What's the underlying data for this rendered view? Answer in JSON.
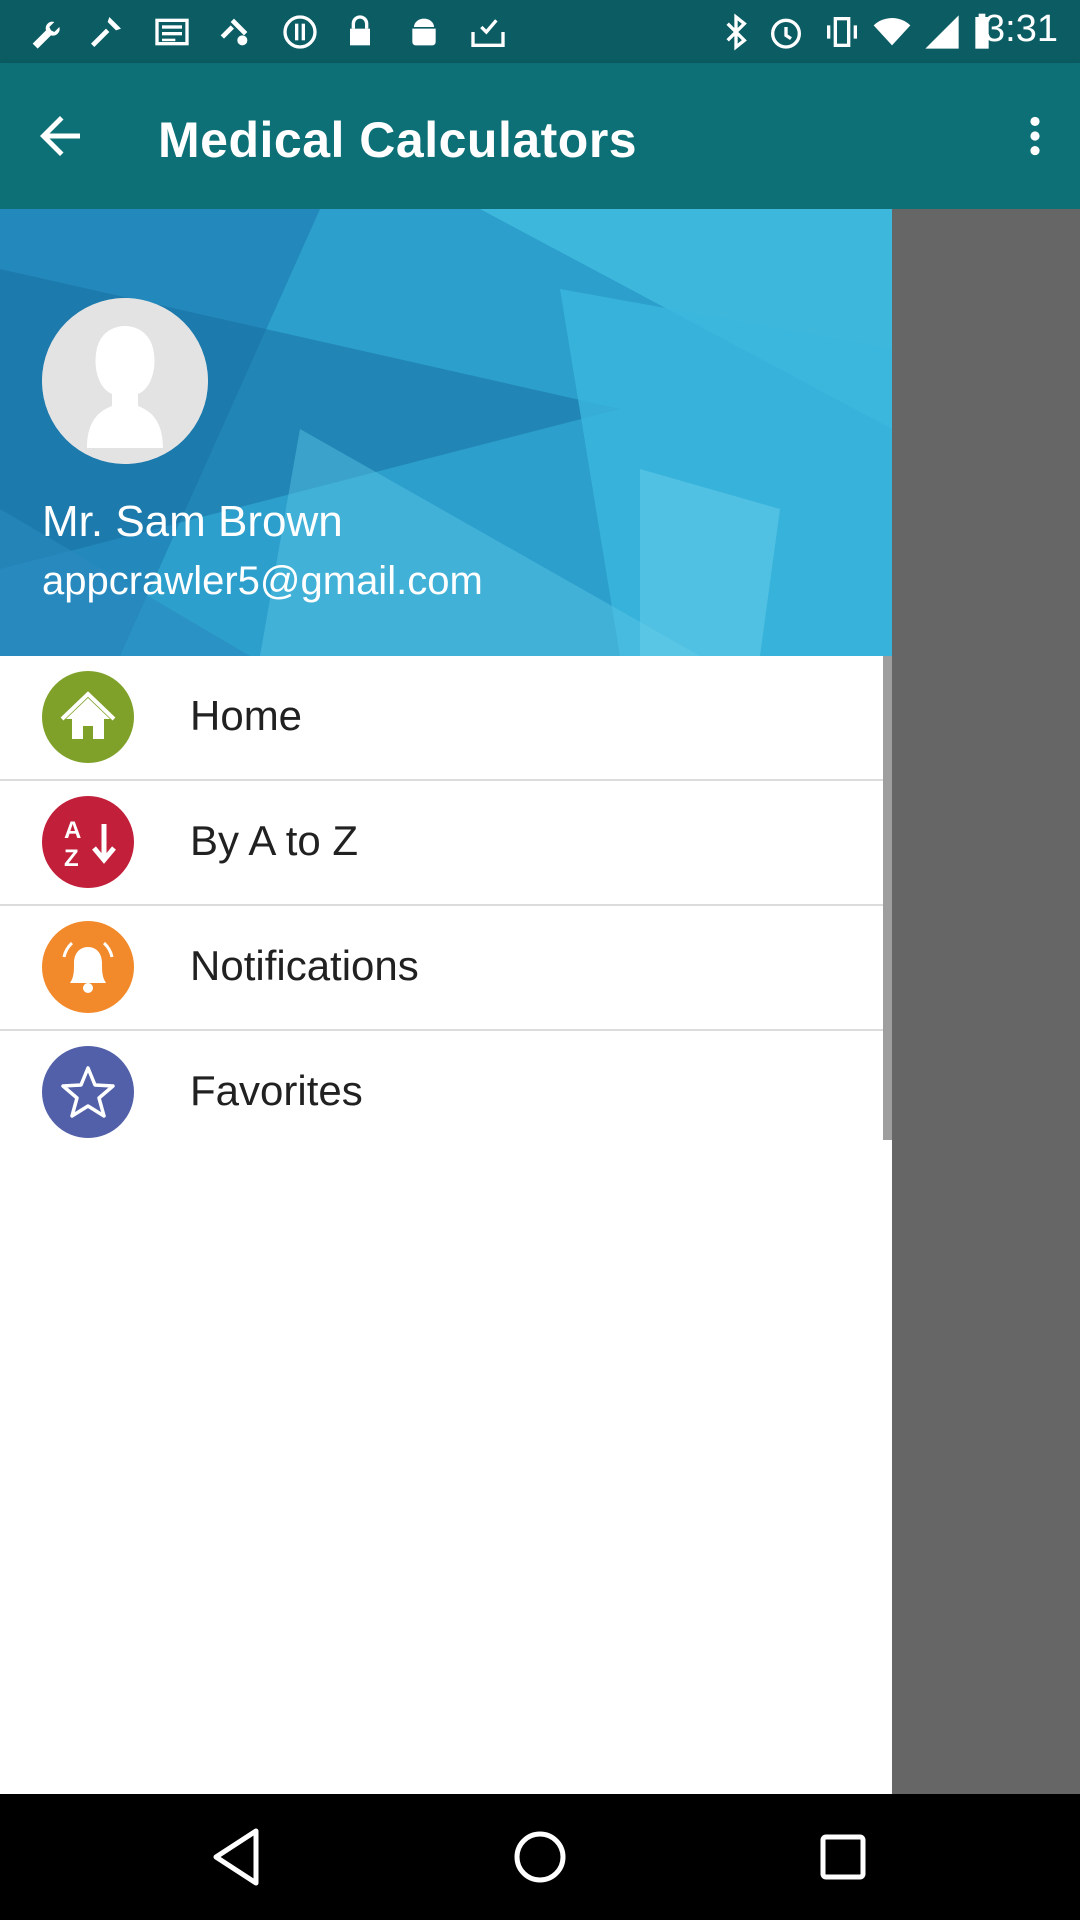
{
  "status_bar": {
    "time": "3:31",
    "left_icons": [
      "wrench-icon",
      "news-icon",
      "fake-gps-icon",
      "circle-icon",
      "lock-icon",
      "android-icon",
      "inbox-check-icon"
    ],
    "right_icons": [
      "bluetooth-icon",
      "alarm-icon",
      "vibrate-icon",
      "wifi-icon",
      "signal-icon",
      "battery-icon"
    ]
  },
  "app_bar": {
    "title": "Medical Calculators",
    "back_icon": "arrow-back-icon",
    "menu_icon": "more-vert-icon"
  },
  "drawer": {
    "user": {
      "name": "Mr. Sam Brown",
      "email": "appcrawler5@gmail.com"
    },
    "items": [
      {
        "label": "Home",
        "icon": "home-icon",
        "color": "#7fa12a"
      },
      {
        "label": "By A to Z",
        "icon": "sort-az-icon",
        "color": "#c21f3a"
      },
      {
        "label": "Notifications",
        "icon": "bell-icon",
        "color": "#f2892a"
      },
      {
        "label": "Favorites",
        "icon": "star-icon",
        "color": "#5160a8"
      }
    ]
  },
  "colors": {
    "status_bar": "#0b5c63",
    "app_bar": "#0d7077",
    "drawer_header": "#2fa3cf",
    "scrim": "#666666"
  },
  "nav_bar": {
    "buttons": [
      "back-triangle-icon",
      "home-circle-icon",
      "recents-square-icon"
    ]
  }
}
